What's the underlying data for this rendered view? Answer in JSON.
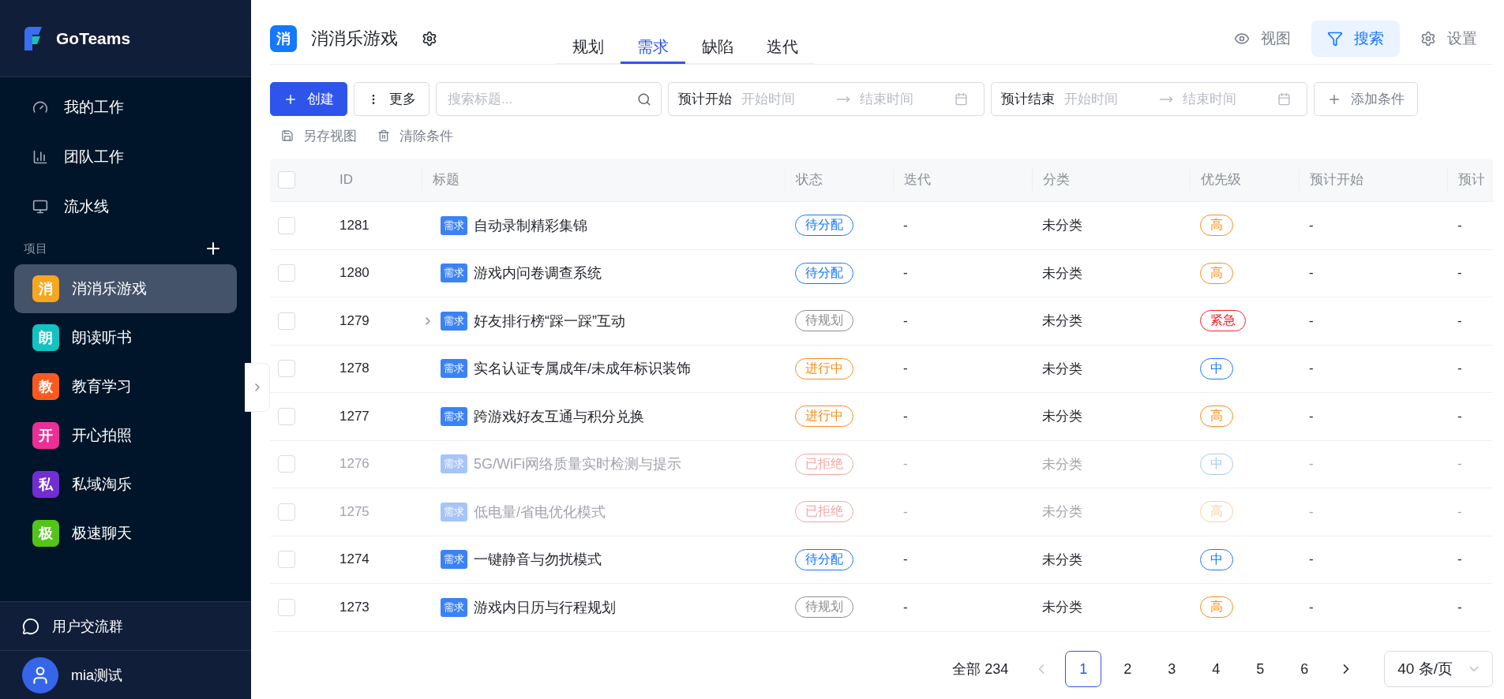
{
  "sidebar": {
    "brand": "GoTeams",
    "nav": [
      {
        "label": "我的工作",
        "selected": false
      },
      {
        "label": "团队工作",
        "selected": false
      },
      {
        "label": "流水线",
        "selected": false
      }
    ],
    "section_title": "项目",
    "projects": [
      {
        "badge": "消",
        "name": "消消乐游戏",
        "color": "#f5a623",
        "selected": true
      },
      {
        "badge": "朗",
        "name": "朗读听书",
        "color": "#13c2c2",
        "selected": false
      },
      {
        "badge": "教",
        "name": "教育学习",
        "color": "#fa5a1e",
        "selected": false
      },
      {
        "badge": "开",
        "name": "开心拍照",
        "color": "#eb2f96",
        "selected": false
      },
      {
        "badge": "私",
        "name": "私域淘乐",
        "color": "#722ed1",
        "selected": false
      },
      {
        "badge": "极",
        "name": "极速聊天",
        "color": "#52c41a",
        "selected": false
      }
    ],
    "community": "用户交流群",
    "user": "mia测试"
  },
  "header": {
    "project_badge": "消",
    "project_name": "消消乐游戏",
    "tabs": [
      {
        "label": "规划",
        "selected": false
      },
      {
        "label": "需求",
        "selected": true
      },
      {
        "label": "缺陷",
        "selected": false
      },
      {
        "label": "迭代",
        "selected": false
      }
    ],
    "actions": [
      {
        "label": "视图",
        "selected": false
      },
      {
        "label": "搜索",
        "selected": true
      },
      {
        "label": "设置",
        "selected": false
      }
    ]
  },
  "toolbar": {
    "create": "创建",
    "more": "更多",
    "search": {
      "placeholder": "搜索标题..."
    },
    "date_filters": [
      {
        "label": "预计开始",
        "start_placeholder": "开始时间",
        "end_placeholder": "结束时间"
      },
      {
        "label": "预计结束",
        "start_placeholder": "开始时间",
        "end_placeholder": "结束时间"
      }
    ],
    "add_condition": "添加条件",
    "save_view": "另存视图",
    "clear": "清除条件"
  },
  "table": {
    "select_all_checked": false,
    "columns": [
      "ID",
      "标题",
      "状态",
      "迭代",
      "分类",
      "优先级",
      "预计开始",
      "预计"
    ],
    "rows": [
      {
        "id": "1281",
        "type": "需求",
        "title": "自动录制精彩集锦",
        "expandable": false,
        "status": {
          "text": "待分配",
          "color": "#1677ff"
        },
        "iteration": "-",
        "category": "未分类",
        "priority": {
          "text": "高",
          "color": "#fa8c16"
        },
        "start": "-",
        "end": "-",
        "disabled": false,
        "checked": false
      },
      {
        "id": "1280",
        "type": "需求",
        "title": "游戏内问卷调查系统",
        "expandable": false,
        "status": {
          "text": "待分配",
          "color": "#1677ff"
        },
        "iteration": "-",
        "category": "未分类",
        "priority": {
          "text": "高",
          "color": "#fa8c16"
        },
        "start": "-",
        "end": "-",
        "disabled": false,
        "checked": false
      },
      {
        "id": "1279",
        "type": "需求",
        "title": "好友排行榜“踩一踩”互动",
        "expandable": true,
        "status": {
          "text": "待规划",
          "color": "#8c8c8c"
        },
        "iteration": "-",
        "category": "未分类",
        "priority": {
          "text": "紧急",
          "color": "#f5222d"
        },
        "start": "-",
        "end": "-",
        "disabled": false,
        "checked": false
      },
      {
        "id": "1278",
        "type": "需求",
        "title": "实名认证专属成年/未成年标识装饰",
        "expandable": false,
        "status": {
          "text": "进行中",
          "color": "#fa8c16"
        },
        "iteration": "-",
        "category": "未分类",
        "priority": {
          "text": "中",
          "color": "#1677ff"
        },
        "start": "-",
        "end": "-",
        "disabled": false,
        "checked": false
      },
      {
        "id": "1277",
        "type": "需求",
        "title": "跨游戏好友互通与积分兑换",
        "expandable": false,
        "status": {
          "text": "进行中",
          "color": "#fa8c16"
        },
        "iteration": "-",
        "category": "未分类",
        "priority": {
          "text": "高",
          "color": "#fa8c16"
        },
        "start": "-",
        "end": "-",
        "disabled": false,
        "checked": false
      },
      {
        "id": "1276",
        "type": "需求",
        "title": "5G/WiFi网络质量实时检测与提示",
        "expandable": false,
        "status": {
          "text": "已拒绝",
          "color": "#f5a3a3"
        },
        "iteration": "-",
        "category": "未分类",
        "priority": {
          "text": "中",
          "color": "#a6c8f5"
        },
        "start": "-",
        "end": "-",
        "disabled": true,
        "checked": false
      },
      {
        "id": "1275",
        "type": "需求",
        "title": "低电量/省电优化模式",
        "expandable": false,
        "status": {
          "text": "已拒绝",
          "color": "#f5a3a3"
        },
        "iteration": "-",
        "category": "未分类",
        "priority": {
          "text": "高",
          "color": "#f8cfa0"
        },
        "start": "-",
        "end": "-",
        "disabled": true,
        "checked": false
      },
      {
        "id": "1274",
        "type": "需求",
        "title": "一键静音与勿扰模式",
        "expandable": false,
        "status": {
          "text": "待分配",
          "color": "#1677ff"
        },
        "iteration": "-",
        "category": "未分类",
        "priority": {
          "text": "中",
          "color": "#1677ff"
        },
        "start": "-",
        "end": "-",
        "disabled": false,
        "checked": false
      },
      {
        "id": "1273",
        "type": "需求",
        "title": "游戏内日历与行程规划",
        "expandable": false,
        "status": {
          "text": "待规划",
          "color": "#8c8c8c"
        },
        "iteration": "-",
        "category": "未分类",
        "priority": {
          "text": "高",
          "color": "#fa8c16"
        },
        "start": "-",
        "end": "-",
        "disabled": false,
        "checked": false
      }
    ]
  },
  "pagination": {
    "total": "全部 234",
    "pages": [
      {
        "label": "1",
        "selected": true
      },
      {
        "label": "2",
        "selected": false
      },
      {
        "label": "3",
        "selected": false
      },
      {
        "label": "4",
        "selected": false
      },
      {
        "label": "5",
        "selected": false
      },
      {
        "label": "6",
        "selected": false
      }
    ],
    "page_size": "40 条/页"
  }
}
